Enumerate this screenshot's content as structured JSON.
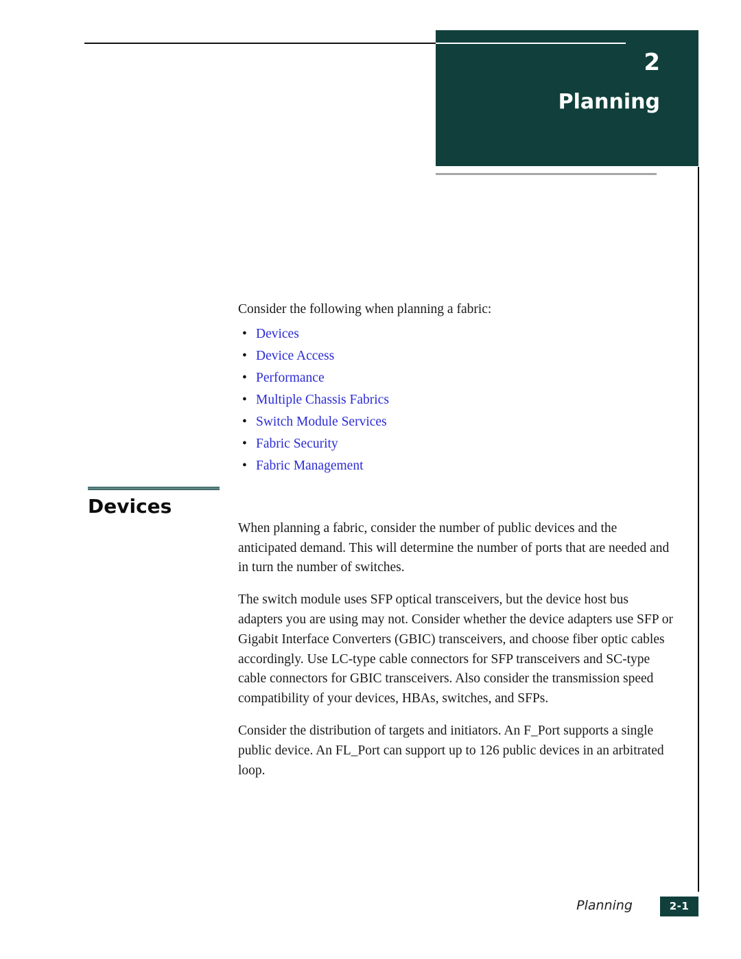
{
  "banner": {
    "chapter_number": "2",
    "chapter_title": "Planning",
    "background_color": "#11403C"
  },
  "intro": {
    "lead": "Consider the following when planning a fabric:",
    "links": [
      "Devices",
      "Device Access",
      "Performance",
      "Multiple Chassis Fabrics",
      "Switch Module Services",
      "Fabric Security",
      "Fabric Management"
    ],
    "link_color": "#2b2bd6",
    "bullet_glyph": "•"
  },
  "section": {
    "heading": "Devices",
    "rule_color": "#5d8583",
    "paragraphs": [
      "When planning a fabric, consider the number of public devices and the anticipated demand. This will determine the number of ports that are needed and in turn the number of switches.",
      "The switch module uses SFP optical transceivers, but the device host bus adapters you are using may not. Consider whether the device adapters use SFP or Gigabit Interface Converters (GBIC) transceivers, and choose fiber optic cables accordingly. Use LC-type cable connectors for SFP transceivers and SC-type cable connectors for GBIC transceivers. Also consider the transmission speed compatibility of your devices, HBAs, switches, and SFPs.",
      "Consider the distribution of targets and initiators. An F_Port supports a single public device. An FL_Port can support up to 126 public devices in an arbitrated loop."
    ]
  },
  "footer": {
    "chapter_label": "Planning",
    "page_number": "2-1",
    "page_box_color": "#11403C"
  }
}
